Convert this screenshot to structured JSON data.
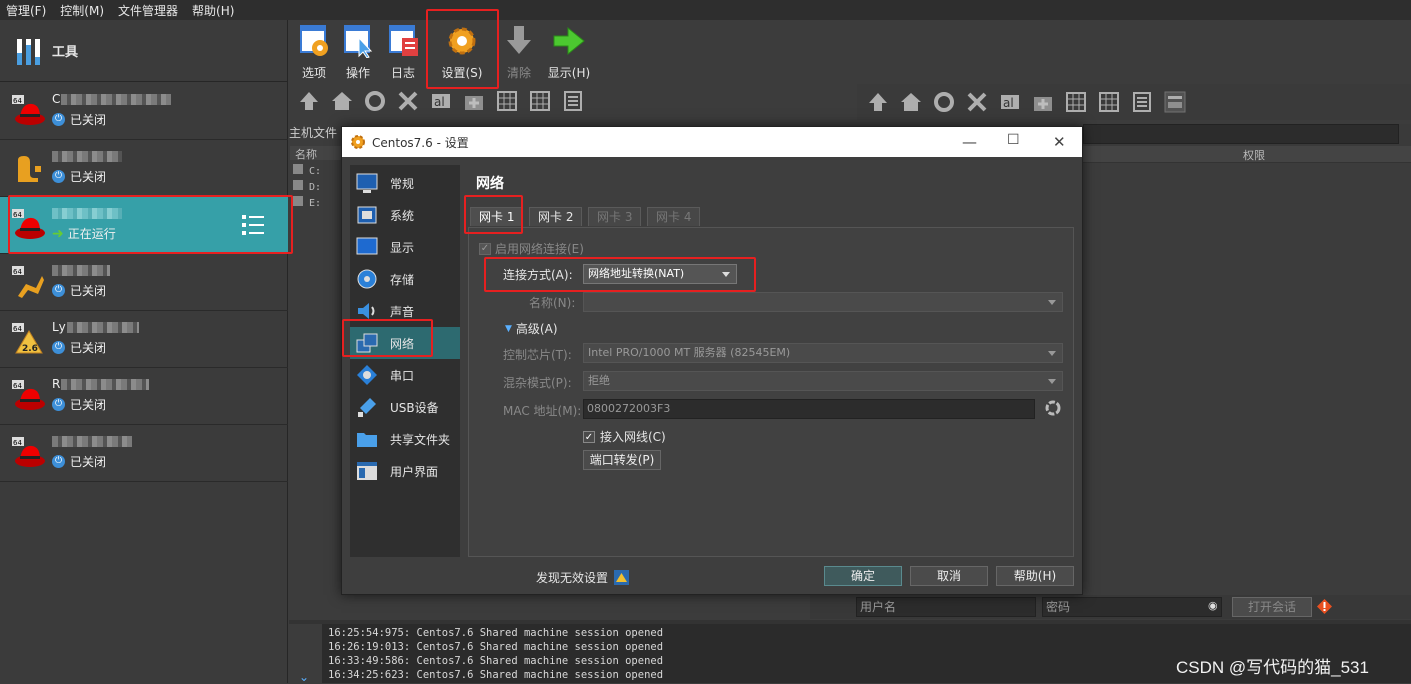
{
  "menubar": {
    "items": [
      "管理(F)",
      "控制(M)",
      "文件管理器",
      "帮助(H)"
    ]
  },
  "tools": {
    "label": "工具"
  },
  "vm_list": [
    {
      "name": "C",
      "state": "已关闭",
      "icon": "redhat-icon"
    },
    {
      "name": "",
      "state": "已关闭",
      "icon": "ubuntu-icon"
    },
    {
      "name": "",
      "state": "正在运行",
      "icon": "redhat-icon",
      "selected": true
    },
    {
      "name": "",
      "state": "已关闭",
      "icon": "debian-icon"
    },
    {
      "name": "Ly",
      "state": "已关闭",
      "icon": "linux26-icon"
    },
    {
      "name": "R",
      "state": "已关闭",
      "icon": "redhat-icon"
    },
    {
      "name": "",
      "state": "已关闭",
      "icon": "redhat-icon"
    }
  ],
  "toolbar": {
    "options": "选项",
    "actions": "操作",
    "log": "日志",
    "settings": "设置(S)",
    "clear": "清除",
    "show": "显示(H)"
  },
  "file_manager": {
    "host_label": "主机文件",
    "name_col": "名称",
    "drives": [
      "C:",
      "D:",
      "E:"
    ],
    "perm_col": "权限"
  },
  "dialog": {
    "title": "Centos7.6 - 设置",
    "nav": [
      "常规",
      "系统",
      "显示",
      "存储",
      "声音",
      "网络",
      "串口",
      "USB设备",
      "共享文件夹",
      "用户界面"
    ],
    "section_title": "网络",
    "tabs": [
      "网卡 1",
      "网卡 2",
      "网卡 3",
      "网卡 4"
    ],
    "enable_label": "启用网络连接(E)",
    "attached_label": "连接方式(A):",
    "attached_value": "网络地址转换(NAT)",
    "name_label": "名称(N):",
    "advanced_label": "高级(A)",
    "adapter_label": "控制芯片(T):",
    "adapter_value": "Intel PRO/1000 MT 服务器 (82545EM)",
    "promisc_label": "混杂模式(P):",
    "promisc_value": "拒绝",
    "mac_label": "MAC 地址(M):",
    "mac_value": "0800272003F3",
    "cable_label": "接入网线(C)",
    "port_fwd": "端口转发(P)",
    "invalid_label": "发现无效设置",
    "ok": "确定",
    "cancel": "取消",
    "help": "帮助(H)"
  },
  "session": {
    "user_placeholder": "用户名",
    "pass_placeholder": "密码",
    "open": "打开会话"
  },
  "log_lines": [
    "16:25:54:975: Centos7.6 Shared machine session opened",
    "16:26:19:013: Centos7.6 Shared machine session opened",
    "16:33:49:586: Centos7.6 Shared machine session opened",
    "16:34:25:623: Centos7.6 Shared machine session opened"
  ],
  "watermark": "CSDN @写代码的猫_531",
  "colors": {
    "selected": "#36a0a8",
    "highlight": "#e62020",
    "nav_active": "#2d6a70"
  }
}
